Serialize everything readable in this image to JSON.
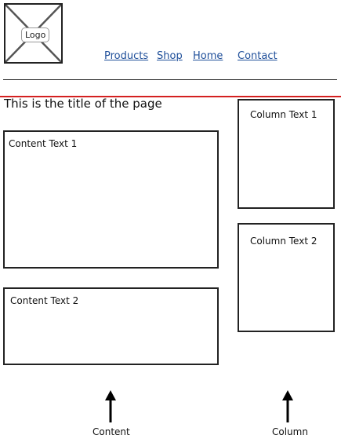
{
  "logo": {
    "label": "Logo"
  },
  "nav": {
    "products": "Products",
    "shop": "Shop",
    "home": "Home",
    "contact": "Contact"
  },
  "page_title": "This is the title of the page",
  "content": {
    "box1": "Content Text 1",
    "box2": "Content Text 2"
  },
  "column": {
    "box1": "Column Text 1",
    "box2": "Column Text 2"
  },
  "annotations": {
    "content": "Content",
    "column": "Column"
  },
  "colors": {
    "link": "#1f4f9a",
    "divider_red": "#d42020",
    "border": "#222222"
  }
}
